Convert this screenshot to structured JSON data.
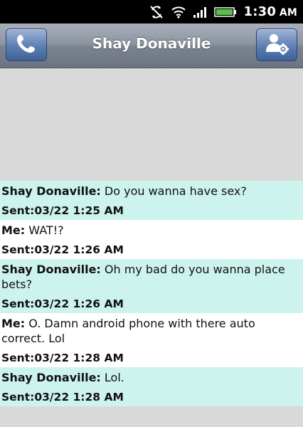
{
  "status_bar": {
    "time": "1:30",
    "ampm": "AM",
    "icons": [
      "sync-off-icon",
      "wifi-icon",
      "signal-icon",
      "battery-icon"
    ]
  },
  "header": {
    "title": "Shay Donaville",
    "call_icon": "phone-icon",
    "contact_icon": "contact-settings-icon"
  },
  "colors": {
    "incoming_bg": "#cdf3ee",
    "outgoing_bg": "#ffffff",
    "empty_area_bg": "#d9d9d9"
  },
  "messages": [
    {
      "sender": "Shay Donaville:",
      "text": "Do you wanna have sex?",
      "sent": "Sent:03/22 1:25 AM"
    },
    {
      "sender": "Me:",
      "text": "WAT!?",
      "sent": "Sent:03/22 1:26 AM"
    },
    {
      "sender": "Shay Donaville:",
      "text": "Oh my bad do you wanna place bets?",
      "sent": "Sent:03/22 1:26 AM"
    },
    {
      "sender": "Me:",
      "text": "O. Damn android phone with there auto correct. Lol",
      "sent": "Sent:03/22 1:28 AM"
    },
    {
      "sender": "Shay Donaville:",
      "text": "Lol.",
      "sent": "Sent:03/22 1:28 AM"
    }
  ]
}
